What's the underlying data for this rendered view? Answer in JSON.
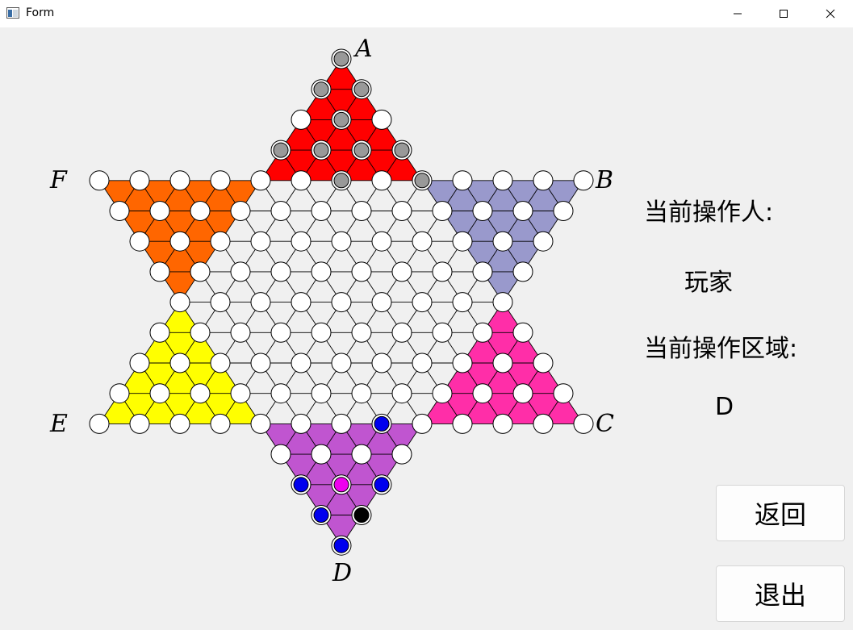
{
  "window": {
    "title": "Form"
  },
  "board": {
    "corner_labels": {
      "top": "A",
      "upper_right": "B",
      "lower_right": "C",
      "bottom": "D",
      "lower_left": "E",
      "upper_left": "F"
    },
    "zone_colors": {
      "A": "#ff0000",
      "B": "#9999cc",
      "C": "#ff2ea8",
      "D": "#c055d0",
      "E": "#ffff00",
      "F": "#ff6600",
      "center": "#f0f0f0"
    },
    "piece_colors": {
      "empty": "#ffffff",
      "gray": "#999999",
      "blue": "#0000ee",
      "magenta": "#ee00ee",
      "black": "#000000"
    },
    "pieces": [
      {
        "cell": [
          0,
          0
        ],
        "color": "gray"
      },
      {
        "cell": [
          1,
          0
        ],
        "color": "gray"
      },
      {
        "cell": [
          1,
          1
        ],
        "color": "gray"
      },
      {
        "cell": [
          2,
          1
        ],
        "color": "gray"
      },
      {
        "cell": [
          3,
          0
        ],
        "color": "gray"
      },
      {
        "cell": [
          3,
          1
        ],
        "color": "gray"
      },
      {
        "cell": [
          3,
          2
        ],
        "color": "gray"
      },
      {
        "cell": [
          3,
          3
        ],
        "color": "gray"
      },
      {
        "cell": [
          4,
          6
        ],
        "color": "gray"
      },
      {
        "cell": [
          4,
          8
        ],
        "color": "gray"
      },
      {
        "cell": [
          12,
          7
        ],
        "color": "blue"
      },
      {
        "cell": [
          13,
          5
        ],
        "color": "blue"
      },
      {
        "cell": [
          13,
          6
        ],
        "color": "magenta"
      },
      {
        "cell": [
          14,
          0
        ],
        "color": "blue"
      },
      {
        "cell": [
          14,
          1
        ],
        "color": "magenta"
      },
      {
        "cell": [
          14,
          2
        ],
        "color": "blue"
      },
      {
        "cell": [
          14,
          3
        ],
        "color": "blue"
      },
      {
        "cell": [
          15,
          0
        ],
        "color": "blue"
      },
      {
        "cell": [
          15,
          1
        ],
        "color": "black"
      },
      {
        "cell": [
          15,
          2
        ],
        "color": "magenta"
      },
      {
        "cell": [
          16,
          0
        ],
        "color": "blue"
      },
      {
        "cell": [
          16,
          1
        ],
        "color": "blue"
      },
      {
        "cell": [
          17,
          0
        ],
        "color": "blue"
      }
    ]
  },
  "sidebar": {
    "operator_label": "当前操作人:",
    "operator_value": "玩家",
    "zone_label": "当前操作区域:",
    "zone_value": "D",
    "back_button": "返回",
    "exit_button": "退出"
  }
}
